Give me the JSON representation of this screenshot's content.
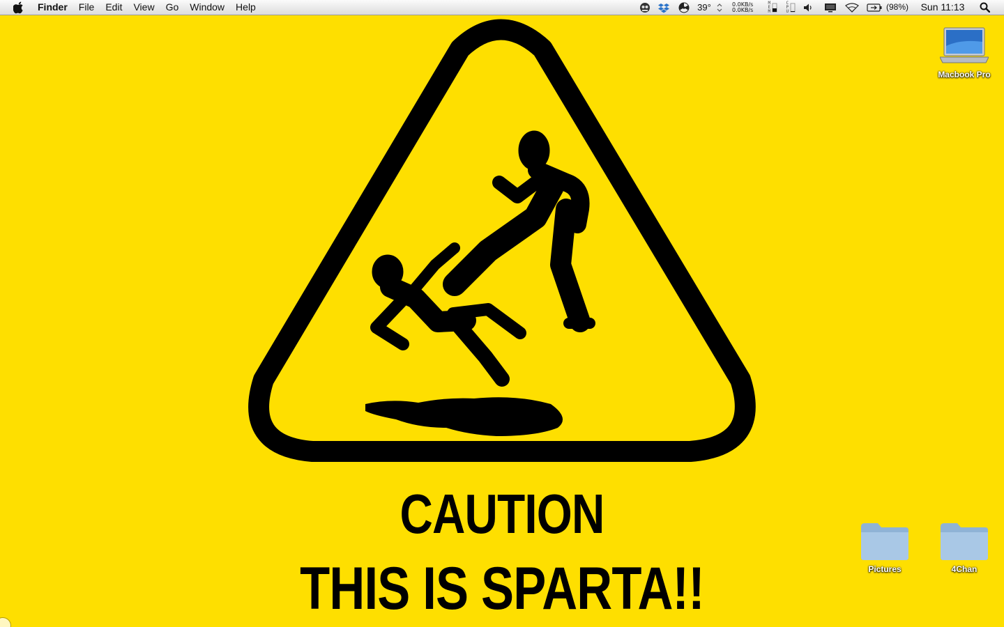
{
  "menubar": {
    "app_name": "Finder",
    "menus": [
      "File",
      "Edit",
      "View",
      "Go",
      "Window",
      "Help"
    ],
    "status": {
      "temperature": "39°",
      "net_up": "0.0KB/s",
      "net_down": "0.0KB/s",
      "mem_label": "MEM",
      "cpu_label": "CPU",
      "battery_percent": "(98%)",
      "clock": "Sun 11:13"
    }
  },
  "wallpaper": {
    "background_color": "#FEDF00",
    "line1": "CAUTION",
    "line2": "THIS IS SPARTA!!"
  },
  "desktop_icons": {
    "macbook": "Macbook Pro",
    "pictures": "Pictures",
    "fourchan": "4Chan"
  },
  "icons": {
    "apple_menu": "apple-logo-icon",
    "spotlight": "magnifier-icon",
    "wifi": "wifi-icon",
    "volume": "speaker-icon",
    "battery": "battery-icon"
  }
}
